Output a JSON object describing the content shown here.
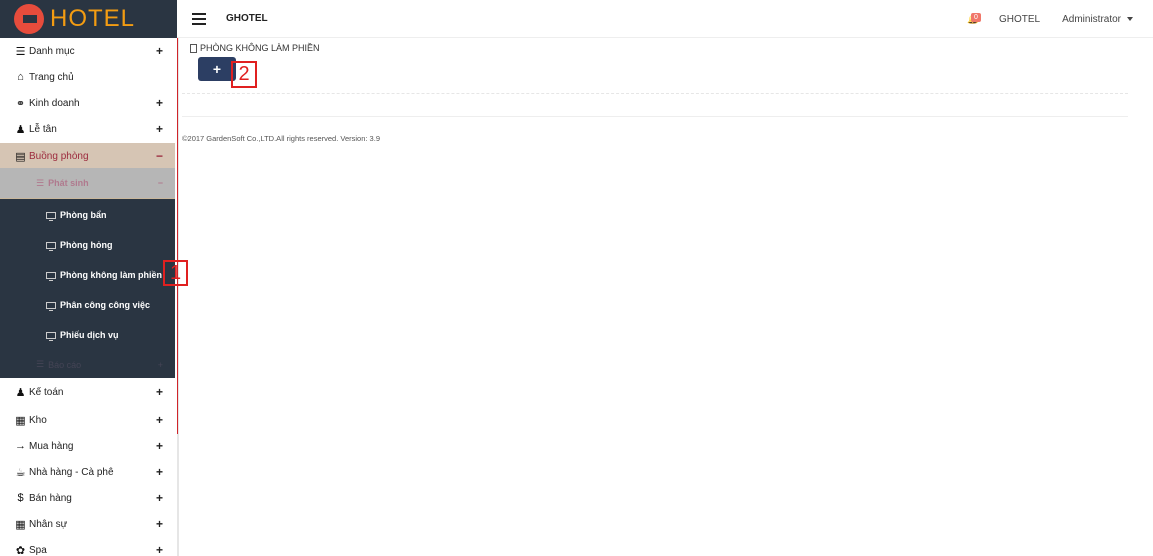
{
  "app": {
    "logo_text": "HOTEL",
    "brand": "GHOTEL"
  },
  "topbar": {
    "notification_count": "0",
    "site": "GHOTEL",
    "user": "Administrator"
  },
  "sidebar": {
    "items": [
      {
        "label": "Danh mục",
        "icon": "list-icon",
        "toggle": "+"
      },
      {
        "label": "Trang chủ",
        "icon": "home-icon",
        "toggle": ""
      },
      {
        "label": "Kinh doanh",
        "icon": "handshake-icon",
        "toggle": "+"
      },
      {
        "label": "Lễ tân",
        "icon": "receptionist-icon",
        "toggle": "+"
      },
      {
        "label": "Buồng phòng",
        "icon": "book-icon",
        "toggle": "−"
      }
    ],
    "submenu_header": {
      "label": "Phát sinh",
      "toggle": "−"
    },
    "submenu_items": [
      {
        "label": "Phòng bẩn"
      },
      {
        "label": "Phòng hỏng"
      },
      {
        "label": "Phòng không làm phiền"
      },
      {
        "label": "Phân công công việc"
      },
      {
        "label": "Phiếu dịch vụ"
      }
    ],
    "submenu_report": {
      "label": "Báo cáo",
      "toggle": "+"
    },
    "items_after": [
      {
        "label": "Kế toán",
        "icon": "accountant-icon",
        "toggle": "+"
      },
      {
        "label": "Kho",
        "icon": "grid-icon",
        "toggle": "+"
      },
      {
        "label": "Mua hàng",
        "icon": "cart-icon",
        "toggle": "+"
      },
      {
        "label": "Nhà hàng - Cà phê",
        "icon": "coffee-icon",
        "toggle": "+"
      },
      {
        "label": "Bán hàng",
        "icon": "dollar-icon",
        "toggle": "+"
      },
      {
        "label": "Nhân sự",
        "icon": "table-icon",
        "toggle": "+"
      },
      {
        "label": "Spa",
        "icon": "leaf-icon",
        "toggle": "+"
      }
    ]
  },
  "main": {
    "breadcrumb": "PHÒNG KHÔNG LÀM PHIỀN",
    "add_label": "+",
    "footer": "©2017 GardenSoft Co.,LTD.All rights reserved. Version: 3.9"
  },
  "markers": {
    "one": "1",
    "two": "2"
  },
  "colors": {
    "sidebar_dark": "#2a3542",
    "accent": "#f39c12",
    "active_bg": "#d6c5b4",
    "button": "#2c3e63",
    "marker": "#e02020"
  }
}
